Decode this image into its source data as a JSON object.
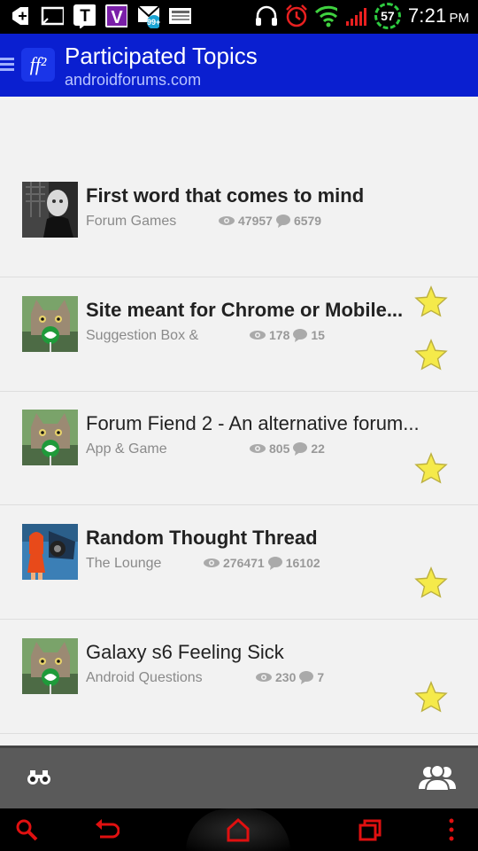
{
  "status_bar": {
    "left_icons": [
      "add-icon",
      "screen-icon",
      "t-app-icon",
      "v-app-icon",
      "mail-icon",
      "news-icon"
    ],
    "mail_badge": "99+",
    "battery_level": "57",
    "time": "7:21",
    "ampm": "PM"
  },
  "app_bar": {
    "title": "Participated Topics",
    "subtitle": "androidforums.com",
    "logo_text": "ff²"
  },
  "topics": [
    {
      "title": "First word that comes to mind",
      "forum": "Forum Games",
      "views": "47957",
      "replies": "6579",
      "bold": true,
      "avatar": "dark-figure"
    },
    {
      "title": "Site meant for Chrome or Mobile...",
      "forum": "Suggestion Box &",
      "views": "178",
      "replies": "15",
      "bold": true,
      "avatar": "cat-lollipop"
    },
    {
      "title": "Forum Fiend 2 - An alternative forum...",
      "forum": "App & Game",
      "views": "805",
      "replies": "22",
      "bold": false,
      "avatar": "cat-lollipop"
    },
    {
      "title": "Random Thought Thread",
      "forum": "The Lounge",
      "views": "276471",
      "replies": "16102",
      "bold": true,
      "avatar": "cartoon-person"
    },
    {
      "title": "Galaxy s6 Feeling Sick",
      "forum": "Android Questions",
      "views": "230",
      "replies": "7",
      "bold": false,
      "avatar": "cat-lollipop"
    }
  ],
  "bottom_bar": {
    "left_icon": "binoculars-icon",
    "right_icon": "people-icon"
  },
  "colors": {
    "app_bar": "#0a1fd0",
    "star": "#f5ea4a",
    "nav_red": "#e01010"
  }
}
